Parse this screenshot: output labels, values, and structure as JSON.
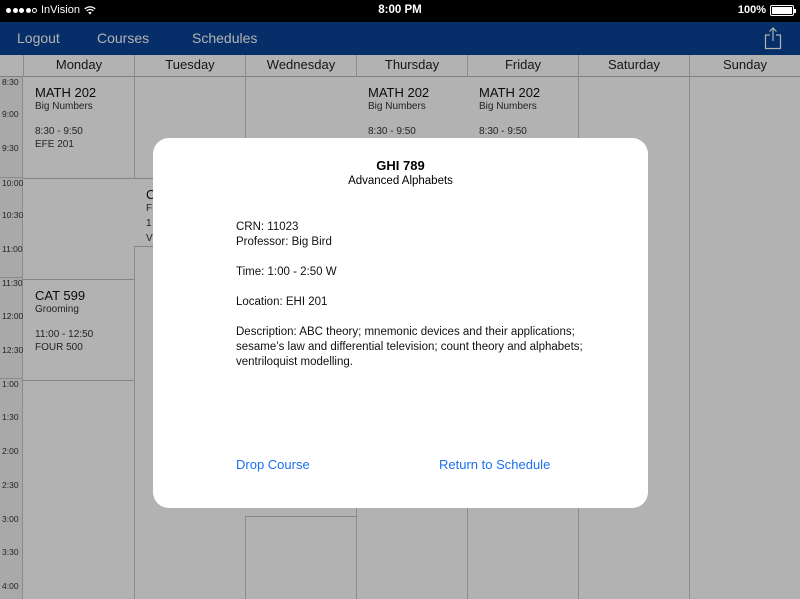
{
  "status_bar": {
    "carrier": "InVision",
    "time": "8:00 PM",
    "battery": "100%"
  },
  "nav": {
    "logout": "Logout",
    "courses": "Courses",
    "schedules": "Schedules"
  },
  "days": [
    "Monday",
    "Tuesday",
    "Wednesday",
    "Thursday",
    "Friday",
    "Saturday",
    "Sunday"
  ],
  "times": [
    "8:30",
    "9:00",
    "9:30",
    "10:00",
    "10:30",
    "11:00",
    "11:30",
    "12:00",
    "12:30",
    "1:00",
    "1:30",
    "2:00",
    "2:30",
    "3:00",
    "3:30",
    "4:00"
  ],
  "events": {
    "mon_math": {
      "code": "MATH 202",
      "name": "Big Numbers",
      "times": "8:30 - 9:50",
      "room": "EFE 201"
    },
    "mon_cat": {
      "code": "CAT 599",
      "name": "Grooming",
      "times": "11:00 - 12:50",
      "room": "FOUR 500"
    },
    "tue_partial": {
      "code": "C",
      "name": "F",
      "times": "1",
      "room": "V"
    },
    "thu_math": {
      "code": "MATH 202",
      "name": "Big Numbers",
      "times": "8:30 - 9:50"
    },
    "fri_math": {
      "code": "MATH 202",
      "name": "Big Numbers",
      "times": "8:30 - 9:50"
    }
  },
  "modal": {
    "code": "GHI 789",
    "title": "Advanced Alphabets",
    "crn": "CRN: 11023",
    "professor": "Professor: Big Bird",
    "time": "Time: 1:00 - 2:50 W",
    "location": "Location: EHI 201",
    "description": "Description: ABC theory; mnemonic devices and their applications; sesame’s law and differential television; count theory and alphabets; ventriloquist modelling.",
    "drop_button": "Drop Course",
    "return_button": "Return to Schedule"
  },
  "colors": {
    "nav_bg": "#0a4296",
    "link": "#1d6ff2"
  }
}
